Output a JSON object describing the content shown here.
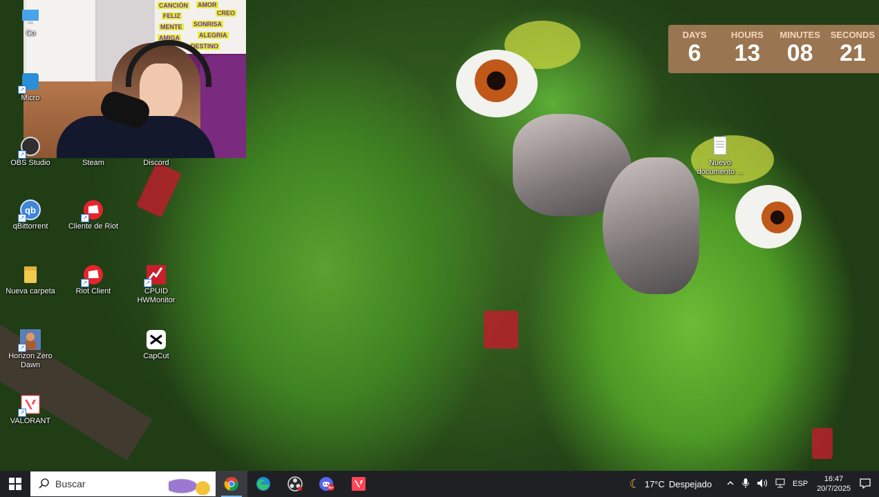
{
  "webcam": {
    "poster_words": [
      "CANCIÓN",
      "AMOR",
      "CREO",
      "FELIZ",
      "SONRISA",
      "MENTE",
      "ALEGRIA",
      "AMIGA",
      "DESTINO"
    ]
  },
  "desktop_icons": [
    {
      "name": "Co",
      "icon": "pc-icon"
    },
    {
      "name": "Micro",
      "icon": "microsoft-icon"
    },
    {
      "name": "OBS Studio",
      "icon": "obs-icon"
    },
    {
      "name": "Steam",
      "icon": "steam-icon"
    },
    {
      "name": "Discord",
      "icon": "discord-icon"
    },
    {
      "name": "qBittorrent",
      "icon": "qbittorrent-icon"
    },
    {
      "name": "Cliente de Riot",
      "icon": "riot-icon"
    },
    {
      "name": "Nueva carpeta",
      "icon": "folder-icon"
    },
    {
      "name": "Riot Client",
      "icon": "riot-icon"
    },
    {
      "name": "CPUID HWMonitor",
      "icon": "hwmonitor-icon"
    },
    {
      "name": "Horizon Zero Dawn",
      "icon": "horizon-icon"
    },
    {
      "name": "CapCut",
      "icon": "capcut-icon"
    },
    {
      "name": "VALORANT",
      "icon": "valorant-icon"
    },
    {
      "name": "Nuevo documento ...",
      "icon": "text-document-icon"
    }
  ],
  "countdown": {
    "units": [
      {
        "label": "DAYS",
        "value": "6"
      },
      {
        "label": "HOURS",
        "value": "13"
      },
      {
        "label": "MINUTES",
        "value": "08"
      },
      {
        "label": "SECONDS",
        "value": "21"
      }
    ]
  },
  "taskbar": {
    "search_placeholder": "Buscar",
    "apps": [
      {
        "name": "Google Chrome",
        "icon": "chrome-icon",
        "active": true
      },
      {
        "name": "Microsoft Edge",
        "icon": "edge-icon",
        "active": false
      },
      {
        "name": "OBS Studio",
        "icon": "obs-icon",
        "active": false
      },
      {
        "name": "Discord",
        "icon": "discord-icon",
        "badge": "9+",
        "active": false
      },
      {
        "name": "VALORANT",
        "icon": "valorant-icon",
        "active": false
      }
    ],
    "weather": {
      "temp": "17°C",
      "condition": "Despejado",
      "icon": "moon-icon"
    },
    "language": "ESP",
    "time": "16:47",
    "date": "20/7/2025"
  },
  "colors": {
    "taskbar_bg": "#1f2024",
    "countdown_bg": "#aa7d5a",
    "accent": "#76b9ed"
  }
}
